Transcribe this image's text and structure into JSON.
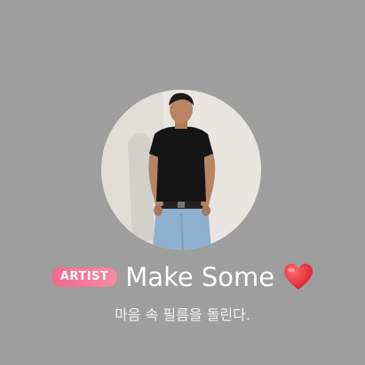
{
  "profile": {
    "badge_label": "ARTIST",
    "display_name": "Make Some",
    "status_message": "마음 속 필름을 돌린다.",
    "name_emoji_icon": "heart-icon"
  },
  "colors": {
    "background": "#9e9e9e",
    "badge": "#f36a8e",
    "heart": "#e8263a",
    "text": "#ffffff"
  }
}
